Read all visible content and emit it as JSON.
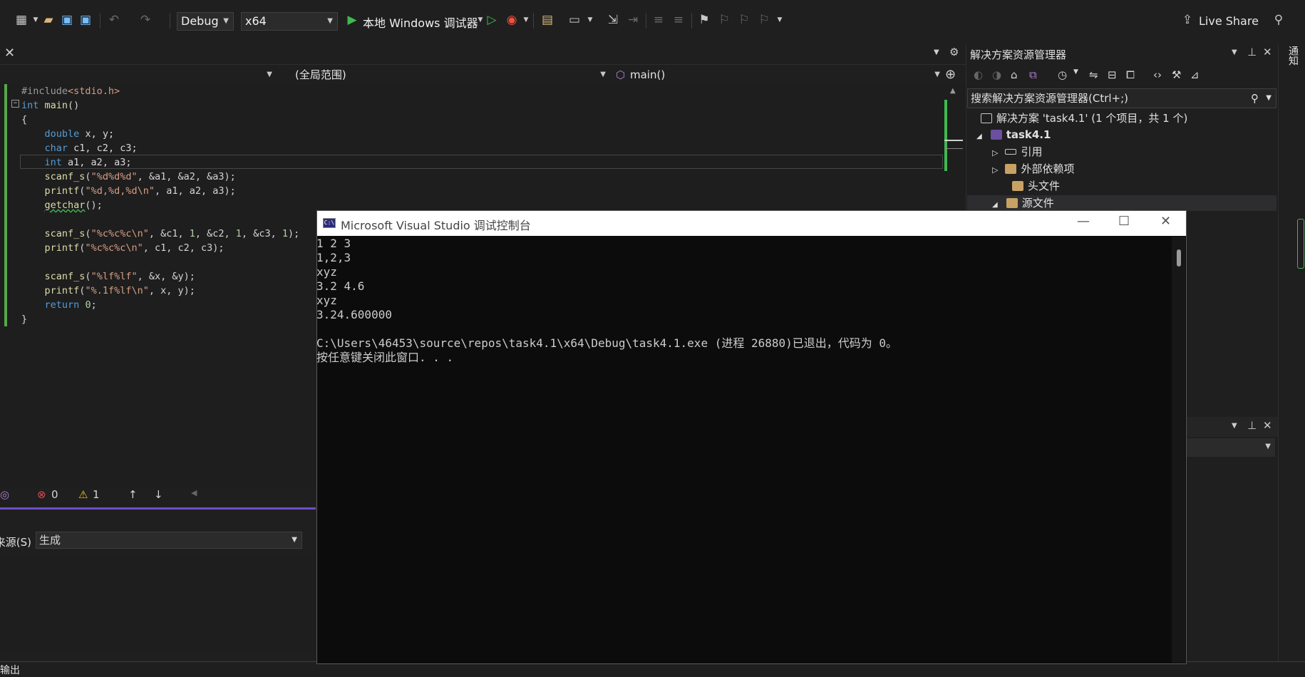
{
  "toolbar": {
    "config": "Debug",
    "platform": "x64",
    "run_label": "本地 Windows 调试器",
    "live_share": "Live Share"
  },
  "nav": {
    "project_scope": "",
    "scope": "(全局范围)",
    "member": "main()"
  },
  "code_lines": [
    "#include<stdio.h>",
    "int main()",
    "{",
    "    double x, y;",
    "    char c1, c2, c3;",
    "    int a1, a2, a3;",
    "    scanf_s(\"%d%d%d\", &a1, &a2, &a3);",
    "    printf(\"%d,%d,%d\\n\", a1, a2, a3);",
    "    getchar();",
    "",
    "    scanf_s(\"%c%c%c\\n\", &c1, 1, &c2, 1, &c3, 1);",
    "    printf(\"%c%c%c\\n\", c1, c2, c3);",
    "",
    "    scanf_s(\"%lf%lf\", &x, &y);",
    "    printf(\"%.1f%lf\\n\", x, y);",
    "    return 0;",
    "}"
  ],
  "errors": {
    "error_count": "0",
    "warning_count": "1"
  },
  "output": {
    "source_label": "来源(S):",
    "source_value": "生成",
    "tab": "输出"
  },
  "solution_explorer": {
    "title": "解决方案资源管理器",
    "search_placeholder": "搜索解决方案资源管理器(Ctrl+;)",
    "items": [
      {
        "label": "解决方案 'task4.1' (1 个项目，共 1 个)"
      },
      {
        "label": "task4.1"
      },
      {
        "label": "引用"
      },
      {
        "label": "外部依赖项"
      },
      {
        "label": "头文件"
      },
      {
        "label": "源文件"
      }
    ]
  },
  "right_rail": {
    "notifications": "通知"
  },
  "console": {
    "title": "Microsoft Visual Studio 调试控制台",
    "lines": [
      "1 2 3",
      "1,2,3",
      "xyz",
      "3.2 4.6",
      "xyz",
      "3.24.600000",
      "",
      "C:\\Users\\46453\\source\\repos\\task4.1\\x64\\Debug\\task4.1.exe (进程 26880)已退出，代码为 0。",
      "按任意键关闭此窗口. . ."
    ]
  },
  "colors": {
    "accent": "#6c4fc8",
    "bg": "#1f1f1f",
    "console_bg": "#0c0c0c",
    "run_green": "#3fb950"
  }
}
